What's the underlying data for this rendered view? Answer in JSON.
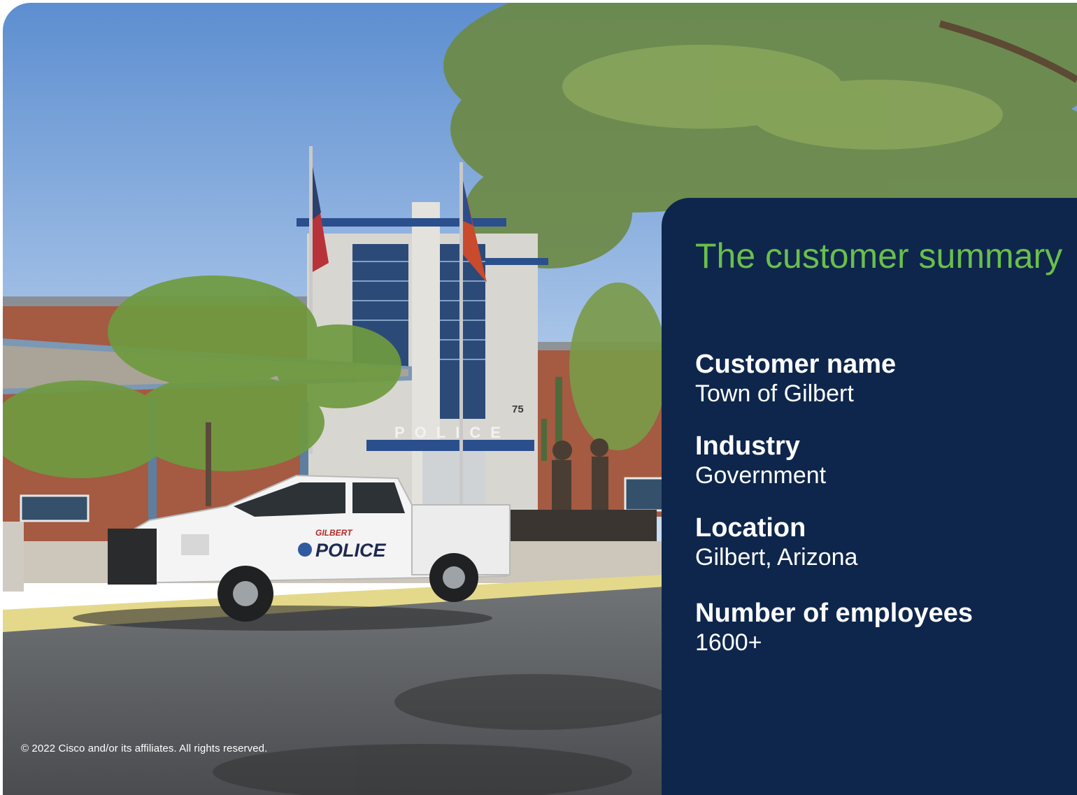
{
  "colors": {
    "panel_background": "#0e264c",
    "heading_accent": "#6abf4b",
    "text_light": "#ffffff"
  },
  "photo": {
    "sign_text": "POLICE",
    "building_number": "75",
    "truck_text_small": "GILBERT",
    "truck_text_large": "POLICE"
  },
  "summary": {
    "heading": "The customer summary",
    "fields": [
      {
        "label": "Customer name",
        "value": "Town of Gilbert"
      },
      {
        "label": "Industry",
        "value": "Government"
      },
      {
        "label": "Location",
        "value": "Gilbert, Arizona"
      },
      {
        "label": "Number of employees",
        "value": "1600+"
      }
    ]
  },
  "footer": {
    "copyright": "© 2022 Cisco and/or its affiliates. All rights reserved."
  }
}
